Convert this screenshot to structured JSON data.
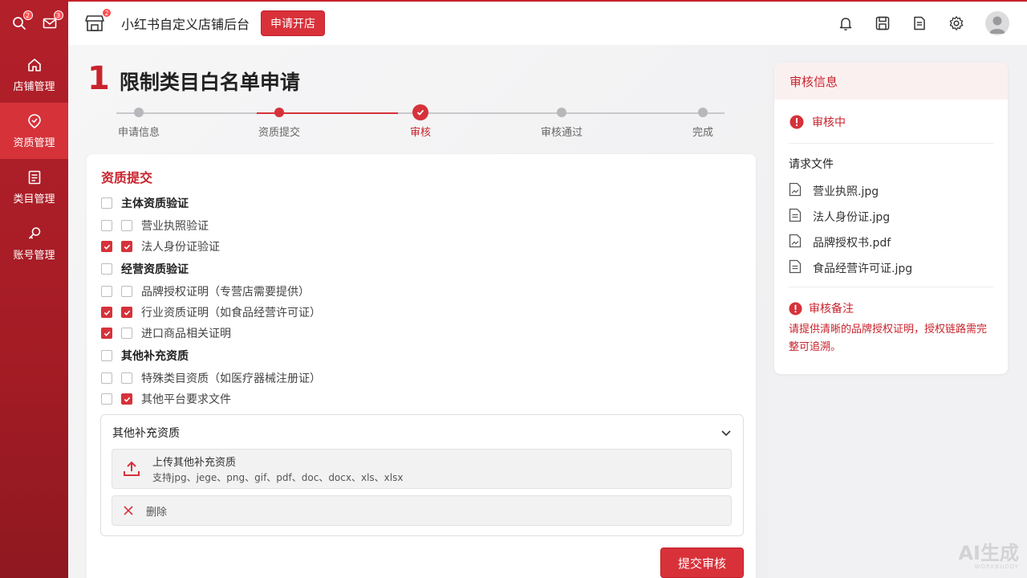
{
  "sidebar": {
    "search_badge": "2",
    "mail_badge": "3",
    "items": [
      {
        "label": "店铺管理",
        "icon": "home-icon",
        "active": false
      },
      {
        "label": "资质管理",
        "icon": "badge-icon",
        "active": true
      },
      {
        "label": "类目管理",
        "icon": "list-icon",
        "active": false
      },
      {
        "label": "账号管理",
        "icon": "key-icon",
        "active": false
      }
    ]
  },
  "topbar": {
    "store_badge": "2",
    "app_title": "小红书自定义店铺后台",
    "apply_button": "申请开店",
    "icons": [
      "bell-icon",
      "save-icon",
      "document-icon",
      "gear-icon",
      "avatar"
    ]
  },
  "page": {
    "step_number": "1",
    "title": "限制类目白名单申请"
  },
  "stepper": {
    "current_index": 2,
    "steps": [
      "申请信息",
      "资质提交",
      "审核",
      "审核通过",
      "完成"
    ]
  },
  "form": {
    "section_title": "资质提交",
    "groups": [
      {
        "label": "主体资质验证",
        "checked": false,
        "items": [
          {
            "label": "营业执照验证",
            "outer": false,
            "inner": false
          },
          {
            "label": "法人身份证验证",
            "outer": true,
            "inner": true
          }
        ]
      },
      {
        "label": "经营资质验证",
        "checked": false,
        "items": [
          {
            "label": "品牌授权证明（专营店需要提供）",
            "outer": false,
            "inner": false
          },
          {
            "label": "行业资质证明（如食品经营许可证）",
            "outer": true,
            "inner": true
          },
          {
            "label": "进口商品相关证明",
            "outer": true,
            "inner": false
          }
        ]
      },
      {
        "label": "其他补充资质",
        "checked": false,
        "items": [
          {
            "label": "特殊类目资质（如医疗器械注册证）",
            "outer": false,
            "inner": false
          },
          {
            "label": "其他平台要求文件",
            "outer": false,
            "inner": true
          }
        ]
      }
    ],
    "collapse": {
      "title": "其他补充资质",
      "upload_title": "上传其他补充资质",
      "upload_hint": "支持jpg、jege、png、gif、pdf、doc、docx、xls、xlsx",
      "delete_label": "删除"
    },
    "submit_label": "提交审核"
  },
  "review": {
    "title": "审核信息",
    "status": "审核中",
    "files_title": "请求文件",
    "files": [
      {
        "name": "营业执照.jpg",
        "icon": "image-file-icon"
      },
      {
        "name": "法人身份证.jpg",
        "icon": "document-file-icon"
      },
      {
        "name": "品牌授权书.pdf",
        "icon": "image-file-icon"
      },
      {
        "name": "食品经营许可证.jpg",
        "icon": "document-file-icon"
      }
    ],
    "note_title": "审核备注",
    "note_text": "请提供清晰的品牌授权证明，授权链路需完整可追溯。"
  },
  "watermark": {
    "line1": "AI生成",
    "line2": "WORKBUDDY"
  },
  "colors": {
    "brand": "#d6323a",
    "sidebar": "#a51c25",
    "status": "#c8232c"
  }
}
